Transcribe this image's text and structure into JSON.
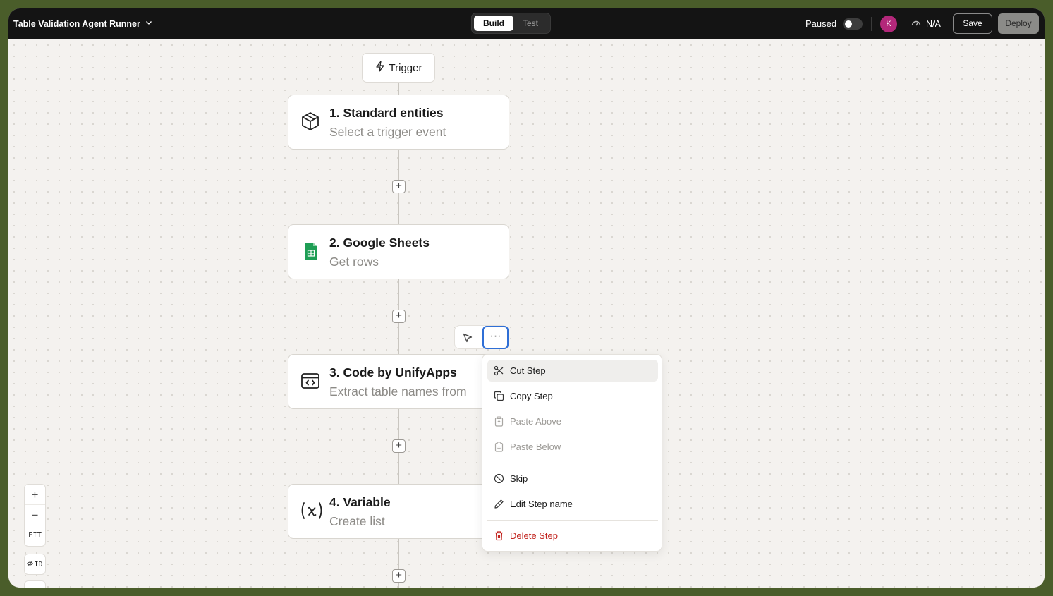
{
  "topbar": {
    "title": "Table Validation Agent Runner",
    "modes": [
      "Build",
      "Test"
    ],
    "active_mode": "Build",
    "status_label": "Paused",
    "paused_toggle_on": false,
    "avatar_initial": "K",
    "avatar_color": "#b3287a",
    "metric_label": "N/A",
    "save_label": "Save",
    "deploy_label": "Deploy"
  },
  "canvas": {
    "trigger_label": "Trigger",
    "steps": [
      {
        "title": "1. Standard entities",
        "subtitle": "Select a trigger event",
        "icon": "box-icon"
      },
      {
        "title": "2. Google Sheets",
        "subtitle": "Get rows",
        "icon": "google-sheets-icon"
      },
      {
        "title": "3. Code by UnifyApps",
        "subtitle": "Extract table names from",
        "icon": "code-window-icon"
      },
      {
        "title": "4. Variable",
        "subtitle": "Create list",
        "icon": "variable-icon"
      }
    ]
  },
  "step_toolbar": {
    "more_label": "···"
  },
  "context_menu": {
    "items": [
      {
        "label": "Cut Step",
        "icon": "scissors-icon",
        "state": "highlighted"
      },
      {
        "label": "Copy Step",
        "icon": "copy-icon",
        "state": "normal"
      },
      {
        "label": "Paste Above",
        "icon": "clipboard-up-icon",
        "state": "disabled"
      },
      {
        "label": "Paste Below",
        "icon": "clipboard-down-icon",
        "state": "disabled"
      },
      {
        "label": "Skip",
        "icon": "skip-circle-icon",
        "state": "normal"
      },
      {
        "label": "Edit Step name",
        "icon": "pencil-icon",
        "state": "normal"
      },
      {
        "label": "Delete Step",
        "icon": "trash-icon",
        "state": "danger"
      }
    ]
  },
  "zoom_controls": {
    "zoom_in": "+",
    "zoom_out": "−",
    "fit_label": "FIT",
    "id_label": "ID"
  },
  "colors": {
    "topbar_bg": "#141414",
    "canvas_bg": "#f4f2ef",
    "selection_blue": "#2f6fd6",
    "danger_red": "#c2231e",
    "sheets_green": "#1e9e55"
  }
}
